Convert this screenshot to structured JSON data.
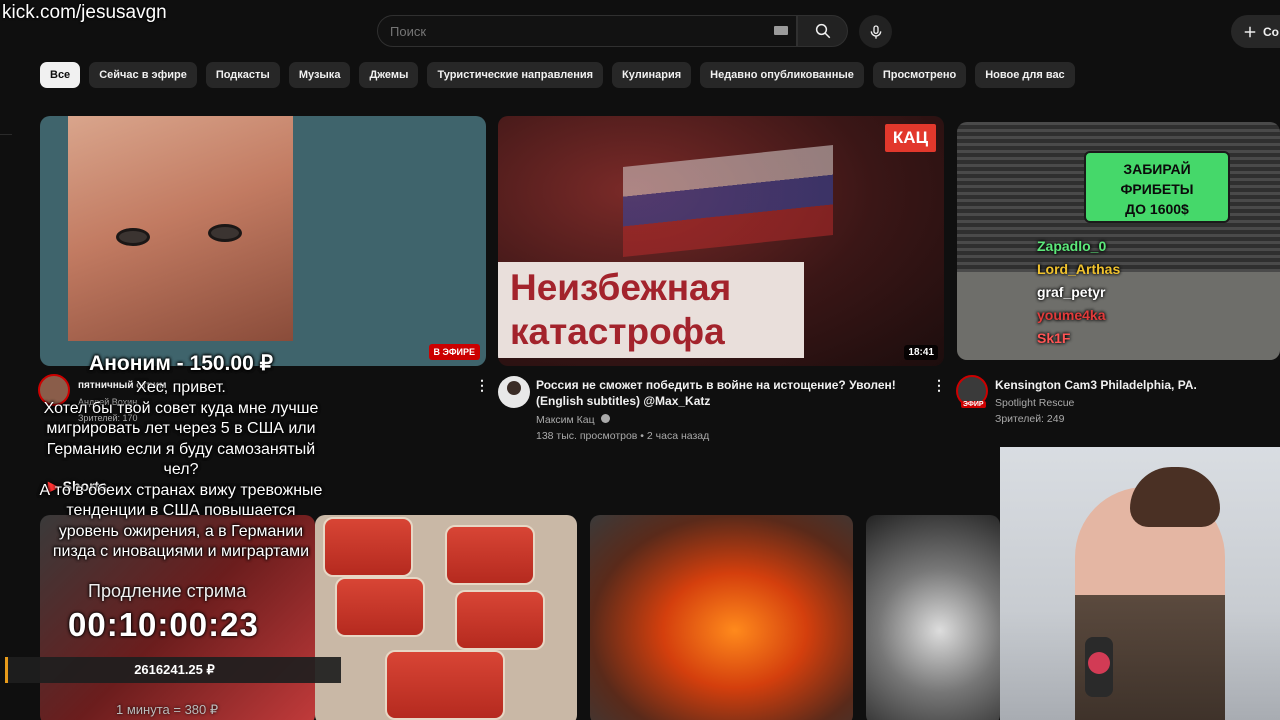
{
  "overlay": {
    "stream_url": "kick.com/jesusavgn",
    "donation_header": "Аноним - 150.00 ₽",
    "donation_lines": [
      "Хес, привет.",
      "Хотел бы твой совет куда мне лучше",
      "мигрировать лет через 5 в США или",
      "Германию если я буду самозанятый",
      "чел?",
      "А то в обеих странах вижу тревожные",
      "тенденции в США повышается",
      "уровень ожирения, а в Германии",
      "пизда с иновациями и миграртами"
    ],
    "extension_label": "Продление стрима",
    "extension_timer": "00:10:00:23",
    "total_amount": "2616241.25 ₽",
    "rate_text": "1 минута = 380 ₽"
  },
  "topbar": {
    "search_placeholder": "Поиск",
    "create_label": "Со"
  },
  "chips": [
    "Все",
    "Сейчас в эфире",
    "Подкасты",
    "Музыка",
    "Джемы",
    "Туристические направления",
    "Кулинария",
    "Недавно опубликованные",
    "Просмотрено",
    "Новое для вас"
  ],
  "videos": [
    {
      "channel": "пятничный стрим",
      "author": "Андрей Вохин",
      "stats": "Зрителей: 170",
      "badge": "В ЭФИРЕ",
      "avatar_badge": "ЭФИР"
    },
    {
      "title_line1": "Россия не сможет победить в войне на истощение? Уволен!",
      "title_line2": "(English subtitles) @Max_Katz",
      "channel": "Максим Кац",
      "stats": "138 тыс. просмотров • 2 часа назад",
      "duration": "18:41",
      "thumb_title_line1": "Неизбежная",
      "thumb_title_line2": "катастрофа",
      "thumb_logo": "КАЦ"
    },
    {
      "title": "Kensington Cam3  Philadelphia, PA.",
      "channel": "Spotlight Rescue",
      "stats": "Зрителей: 249",
      "avatar_badge": "ЭФИР",
      "banner_line1": "ЗАБИРАЙ",
      "banner_line2": "ФРИБЕТЫ",
      "banner_line3": "ДО 1600$",
      "chat_names": [
        "Zapadlo_0",
        "Lord_Arthas",
        "graf_petyr",
        "youme4ka",
        "Sk1F"
      ]
    }
  ],
  "shorts": {
    "label": "Shorts"
  },
  "colors": {
    "background": "#0f0f0f",
    "chip_active": "#f1f1f1",
    "live_red": "#cc0000",
    "banner_green": "#45d86a",
    "total_accent": "#e89b1a"
  }
}
